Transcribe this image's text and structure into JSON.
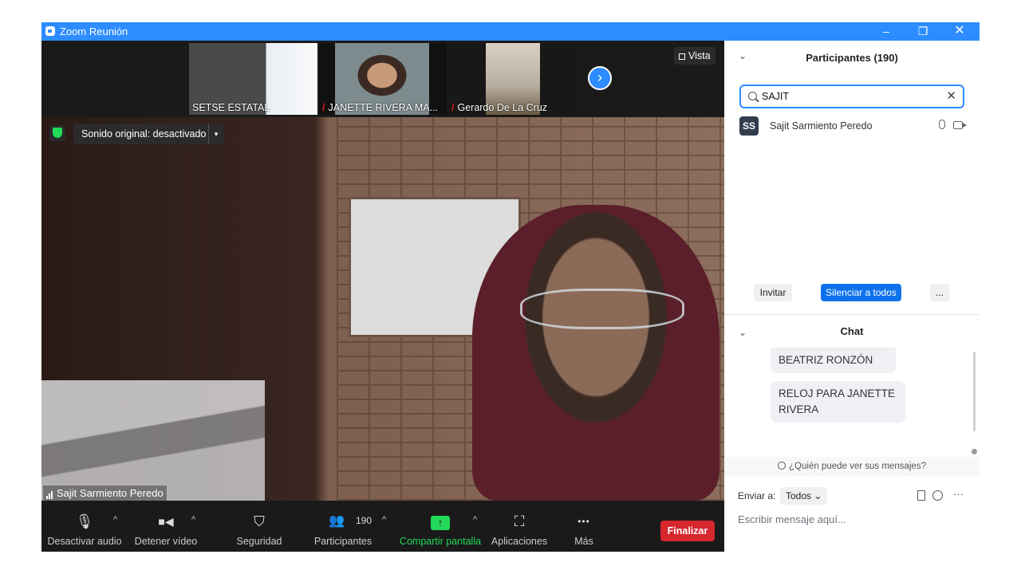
{
  "window": {
    "title": "Zoom Reunión",
    "minimize": "–",
    "maximize": "❐",
    "close": "✕"
  },
  "strip": {
    "tiles": [
      {
        "name": "SETSE ESTATAL",
        "muted": false
      },
      {
        "name": "JANETTE RIVERA MA...",
        "muted": true
      },
      {
        "name": "Gerardo De La Cruz",
        "muted": true
      }
    ],
    "next_icon": "›",
    "view_label": "Vista"
  },
  "video": {
    "sound_label": "Sonido original: desactivado",
    "sound_caret": "▾",
    "speaker_name": "Sajit Sarmiento Peredo"
  },
  "toolbar": {
    "audio_label": "Desactivar audio",
    "video_label": "Detener vídeo",
    "security_label": "Seguridad",
    "participants_label": "Participantes",
    "participants_count": "190",
    "share_label": "Compartir pantalla",
    "apps_label": "Aplicaciones",
    "more_label": "Más",
    "end_label": "Finalizar",
    "caret": "^",
    "mic_icon": "🎙",
    "camera_icon": "■◀",
    "shield_icon": "⛉",
    "people_icon": "👥",
    "share_icon": "↑",
    "apps_icon": "⛶",
    "more_icon": "•••"
  },
  "participants": {
    "title": "Participantes (190)",
    "chevron": "⌄",
    "search_value": "SAJIT",
    "clear": "✕",
    "list": [
      {
        "initials": "SS",
        "name": "Sajit Sarmiento Peredo"
      }
    ],
    "invite_label": "Invitar",
    "mute_all_label": "Silenciar a todos",
    "more_label": "..."
  },
  "chat": {
    "title": "Chat",
    "messages": [
      {
        "text": "BEATRIZ RONZÓN"
      },
      {
        "text": "RELOJ PARA  JANETTE RIVERA"
      }
    ],
    "who_can_see": "¿Quién puede ver sus mensajes?",
    "send_to_label": "Enviar a:",
    "send_to_value": "Todos",
    "send_to_caret": "⌄",
    "placeholder": "Escribir mensaje aquí...",
    "more": "···"
  },
  "colors": {
    "accent": "#2d8cff",
    "end": "#d6262e",
    "share_green": "#23d959",
    "toolbar_bg": "#1a1a1a"
  }
}
